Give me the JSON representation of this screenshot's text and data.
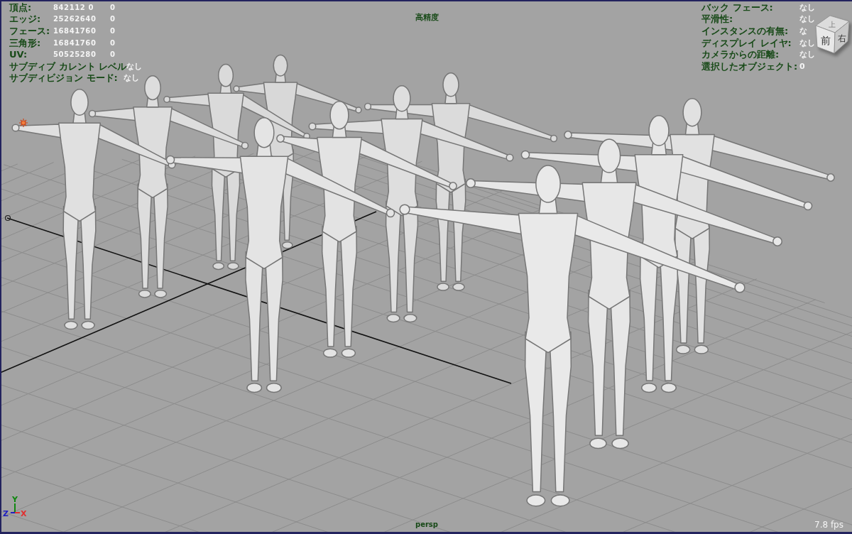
{
  "viewport": {
    "title": "高精度",
    "camera": "persp",
    "fps": "7.8 fps"
  },
  "poly_counts": [
    {
      "label": "頂点:",
      "total": "842112 0",
      "column_3": "0"
    },
    {
      "label": "エッジ:",
      "total": "25262640",
      "column_3": "0"
    },
    {
      "label": "フェース:",
      "total": "16841760",
      "column_3": "0"
    },
    {
      "label": "三角形:",
      "total": "16841760",
      "column_3": "0"
    },
    {
      "label": "UV:",
      "total": "50525280",
      "column_3": "0"
    }
  ],
  "subdiv_info": [
    {
      "label": "サブディブ カレント レベル",
      "value": "なし"
    },
    {
      "label": "サブディビジョン モード:",
      "value": "なし"
    }
  ],
  "object_info": [
    {
      "label": "バック フェース:",
      "value": "なし"
    },
    {
      "label": "平滑性:",
      "value": "なし"
    },
    {
      "label": "インスタンスの有無:",
      "value": "な"
    },
    {
      "label": "ディスプレイ レイヤ:",
      "value": "なし"
    },
    {
      "label": "カメラからの距離:",
      "value": "なし"
    },
    {
      "label": "選択したオブジェクト:",
      "value": "0"
    }
  ],
  "view_cube": [
    {
      "kind": "top",
      "label": "上"
    },
    {
      "kind": "front",
      "label": "前"
    },
    {
      "kind": "right",
      "label": "右"
    }
  ],
  "axes": [
    {
      "kind": "y",
      "label": "Y",
      "color": "#108810"
    },
    {
      "kind": "z",
      "label": "Z",
      "color": "#2020c0"
    },
    {
      "kind": "x",
      "label": "X",
      "color": "#e03030"
    }
  ]
}
